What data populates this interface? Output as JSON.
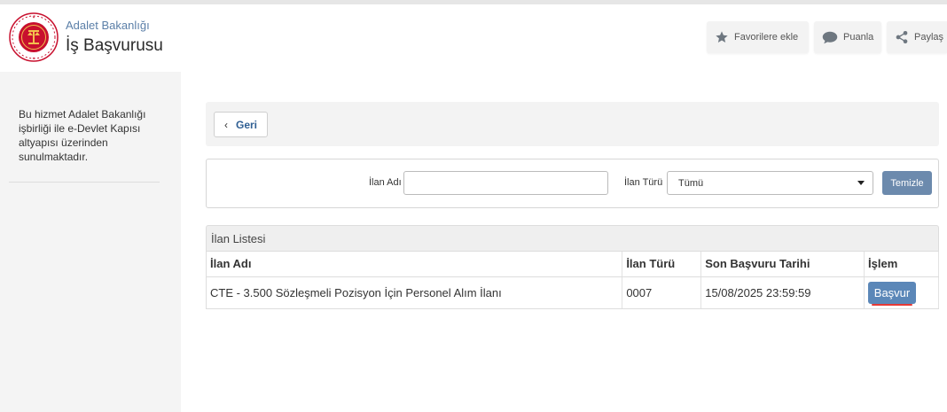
{
  "colors": {
    "brand_red": "#c8102e",
    "link_blue": "#5b7fa8",
    "button_blue": "#5b87b8",
    "clear_button": "#6c8aad",
    "panel_grey": "#f3f3f3"
  },
  "header": {
    "org_name": "Adalet Bakanlığı",
    "service_name": "İş Başvurusu",
    "logo_icon": "ministry-seal-icon",
    "actions": {
      "favorite": {
        "label": "Favorilere ekle",
        "icon": "star-icon"
      },
      "rate": {
        "label": "Puanla",
        "icon": "speech-bubble-icon"
      },
      "share": {
        "label": "Paylaş",
        "icon": "share-icon"
      }
    }
  },
  "sidebar": {
    "info_text": "Bu hizmet Adalet Bakanlığı işbirliği ile e-Devlet Kapısı altyapısı üzerinden sunulmaktadır."
  },
  "main": {
    "back_label": "Geri",
    "back_icon": "chevron-left-icon",
    "filters": {
      "name_label": "İlan Adı",
      "name_value": "",
      "type_label": "İlan Türü",
      "type_value": "Tümü",
      "clear_label": "Temizle"
    },
    "list": {
      "title": "İlan Listesi",
      "columns": [
        "İlan Adı",
        "İlan Türü",
        "Son Başvuru Tarihi",
        "İşlem"
      ],
      "rows": [
        {
          "name": "CTE - 3.500 Sözleşmeli Pozisyon İçin Personel Alım İlanı",
          "type": "0007",
          "deadline": "15/08/2025 23:59:59",
          "action": "Başvur"
        }
      ]
    }
  }
}
